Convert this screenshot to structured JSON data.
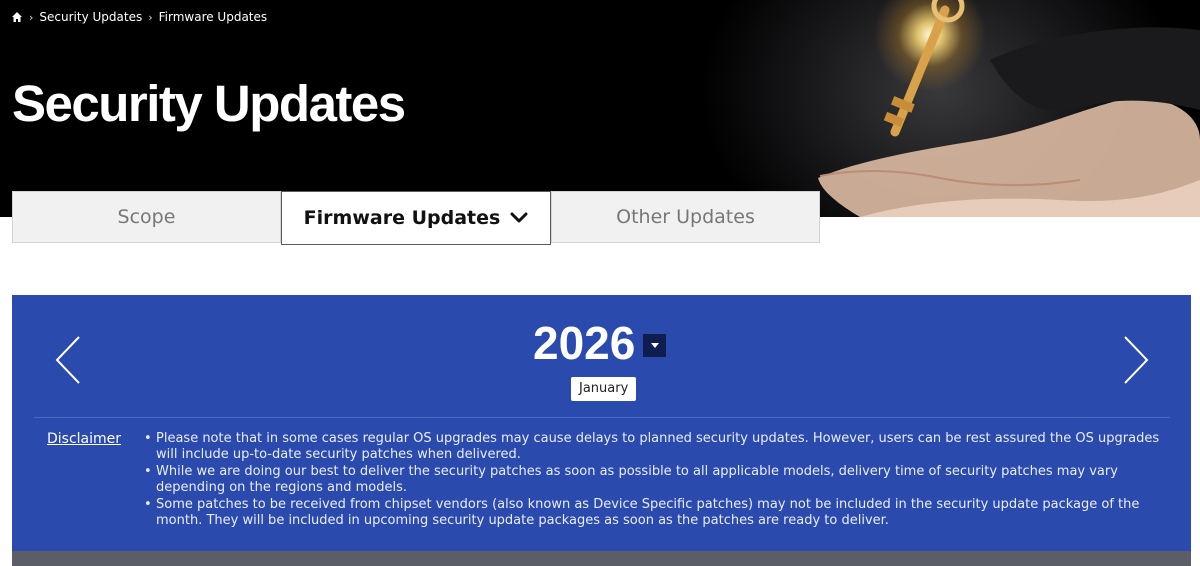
{
  "breadcrumb": {
    "home_icon": "home-icon",
    "items": [
      "Security Updates",
      "Firmware Updates"
    ]
  },
  "header": {
    "title": "Security Updates"
  },
  "tabs": [
    {
      "label": "Scope",
      "active": false
    },
    {
      "label": "Firmware Updates",
      "active": true,
      "icon": "chevron-down-icon"
    },
    {
      "label": "Other Updates",
      "active": false
    }
  ],
  "panel": {
    "year": "2026",
    "month": "January",
    "prev_icon": "chevron-left-icon",
    "next_icon": "chevron-right-icon",
    "disclaimer_label": "Disclaimer",
    "notes": [
      "Please note that in some cases regular OS upgrades may cause delays to planned security updates. However, users can be rest assured the OS upgrades will include up-to-date security patches when delivered.",
      "While we are doing our best to deliver the security patches as soon as possible to all applicable models, delivery time of security patches may vary depending on the regions and models.",
      "Some patches to be received from chipset vendors (also known as Device Specific patches) may not be included in the security update package of the month. They will be included in upcoming security update packages as soon as the patches are ready to deliver."
    ]
  },
  "colors": {
    "panel_bg": "#2b4aae",
    "dropdown_bg": "#101e4f",
    "hero_bg": "#000000"
  }
}
